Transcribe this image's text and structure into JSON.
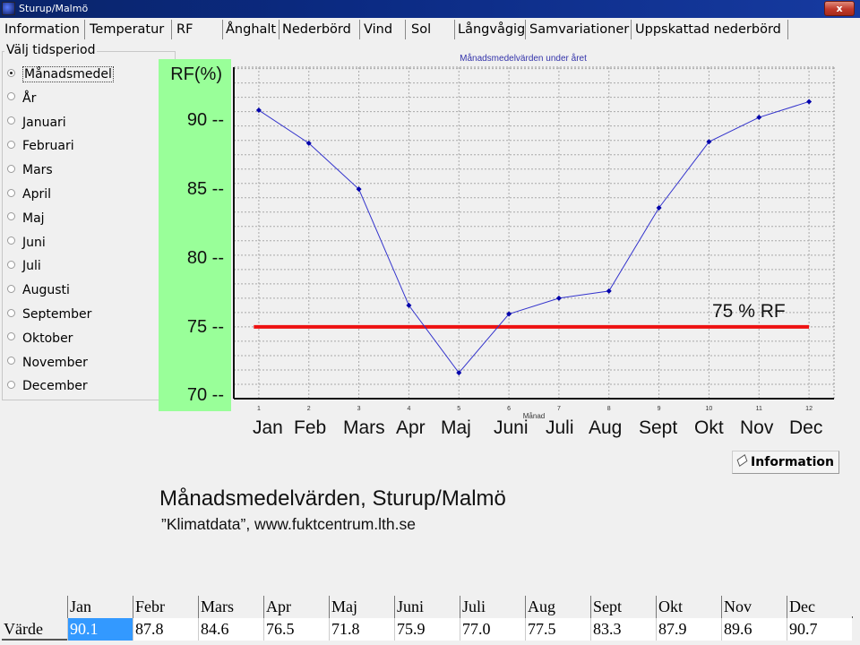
{
  "window": {
    "title": "Sturup/Malmö",
    "close_label": "x"
  },
  "tabs": [
    {
      "label": "Information",
      "selected": false
    },
    {
      "label": "Temperatur",
      "selected": false
    },
    {
      "label": "RF",
      "selected": true
    },
    {
      "label": "Ånghalt",
      "selected": false
    },
    {
      "label": "Nederbörd",
      "selected": false
    },
    {
      "label": "Vind",
      "selected": false
    },
    {
      "label": "Sol",
      "selected": false
    },
    {
      "label": "Långvågig",
      "selected": false
    },
    {
      "label": "Samvariationer",
      "selected": false
    },
    {
      "label": "Uppskattad nederbörd",
      "selected": false
    }
  ],
  "period": {
    "label": "Välj tidsperiod",
    "options": [
      {
        "label": "Månadsmedel",
        "checked": true
      },
      {
        "label": "År",
        "checked": false
      },
      {
        "label": "Januari",
        "checked": false
      },
      {
        "label": "Februari",
        "checked": false
      },
      {
        "label": "Mars",
        "checked": false
      },
      {
        "label": "April",
        "checked": false
      },
      {
        "label": "Maj",
        "checked": false
      },
      {
        "label": "Juni",
        "checked": false
      },
      {
        "label": "Juli",
        "checked": false
      },
      {
        "label": "Augusti",
        "checked": false
      },
      {
        "label": "September",
        "checked": false
      },
      {
        "label": "Oktober",
        "checked": false
      },
      {
        "label": "November",
        "checked": false
      },
      {
        "label": "December",
        "checked": false
      }
    ]
  },
  "y_panel": {
    "unit_label": "RF(%)",
    "labels": [
      {
        "value": 90,
        "text": "90 --"
      },
      {
        "value": 85,
        "text": "85 --"
      },
      {
        "value": 80,
        "text": "80 --"
      },
      {
        "value": 75,
        "text": "75 --"
      },
      {
        "value": 70,
        "text": "70 --"
      }
    ]
  },
  "chart_data": {
    "type": "line",
    "title": "Månadsmedelvärden under året",
    "xlabel": "Månad",
    "ylabel": "RF(%)",
    "x": [
      1,
      2,
      3,
      4,
      5,
      6,
      7,
      8,
      9,
      10,
      11,
      12
    ],
    "x_tick_labels": [
      "1",
      "2",
      "3",
      "4",
      "5",
      "6",
      "7",
      "8",
      "9",
      "10",
      "11",
      "12"
    ],
    "month_labels": [
      "Jan",
      "Feb",
      "Mars",
      "Apr",
      "Maj",
      "Juni",
      "Juli",
      "Aug",
      "Sept",
      "Okt",
      "Nov",
      "Dec"
    ],
    "series": [
      {
        "name": "RF",
        "values": [
          90.1,
          87.8,
          84.6,
          76.5,
          71.8,
          75.9,
          77.0,
          77.5,
          83.3,
          87.9,
          89.6,
          90.7
        ],
        "color": "#3333cc",
        "marker_color": "#0000aa"
      }
    ],
    "reference_line": {
      "value": 75,
      "label": "75 % RF",
      "color": "#ee1111"
    },
    "xlim": [
      0.5,
      12.5
    ],
    "ylim": [
      70,
      93.1
    ],
    "grid": true
  },
  "info_button": {
    "label": "Information",
    "icon": "book-icon"
  },
  "caption": {
    "title": "Månadsmedelvärden, Sturup/Malmö",
    "source": "”Klimatdata”, www.fuktcentrum.lth.se"
  },
  "table": {
    "columns": [
      "Jan",
      "Febr",
      "Mars",
      "Apr",
      "Maj",
      "Juni",
      "Juli",
      "Aug",
      "Sept",
      "Okt",
      "Nov",
      "Dec"
    ],
    "row_label": "Värde",
    "values": [
      "90.1",
      "87.8",
      "84.6",
      "76.5",
      "71.8",
      "75.9",
      "77.0",
      "77.5",
      "83.3",
      "87.9",
      "89.6",
      "90.7"
    ],
    "selected_index": 0,
    "selected_color": "#3399ff"
  }
}
